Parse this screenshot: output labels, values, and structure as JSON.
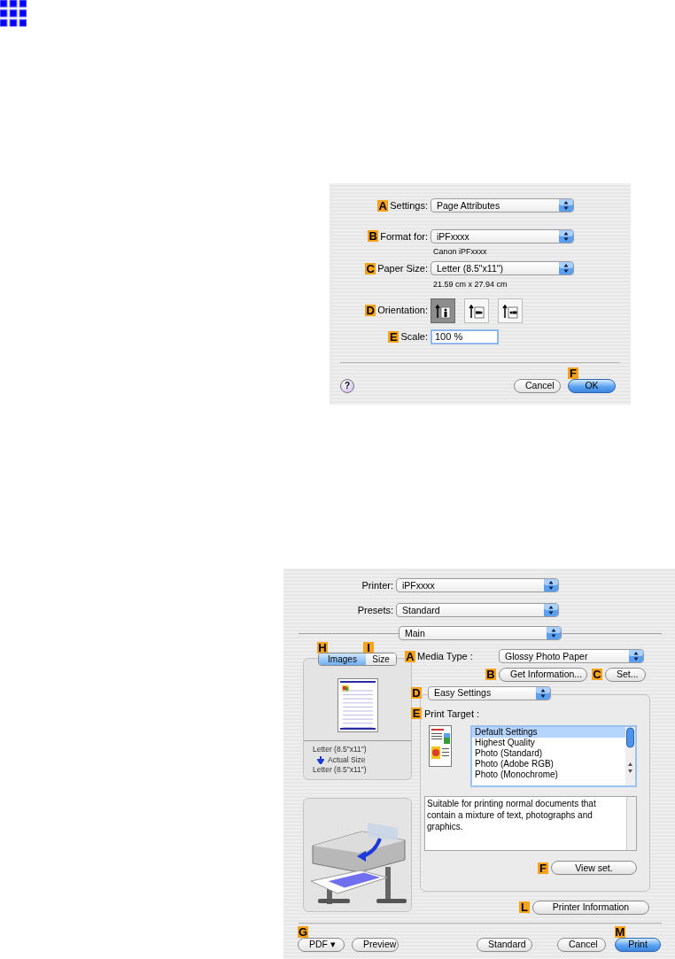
{
  "page_setup": {
    "rows": [
      {
        "badge": "A",
        "label": "Settings:",
        "kind": "popup",
        "value": "Page Attributes"
      },
      {
        "badge": "B",
        "label": "Format for:",
        "kind": "popup",
        "value": "iPFxxxx",
        "note": "Canon iPFxxxx"
      },
      {
        "badge": "C",
        "label": "Paper Size:",
        "kind": "popup",
        "value": "Letter (8.5\"x11\")",
        "note": "21.59 cm x 27.94 cm"
      },
      {
        "badge": "D",
        "label": "Orientation:",
        "kind": "orientation",
        "options": [
          {
            "kind": "portrait",
            "selected": true
          },
          {
            "kind": "landscape",
            "selected": false
          },
          {
            "kind": "reverse",
            "selected": false
          }
        ]
      },
      {
        "badge": "E",
        "label": "Scale:",
        "kind": "field",
        "value": "100 %"
      }
    ],
    "help": "?",
    "buttons": [
      {
        "label": "Cancel",
        "default": false
      },
      {
        "label": "OK",
        "default": true,
        "badge": "F"
      }
    ]
  },
  "print_dialog": {
    "printer": {
      "label": "Printer:",
      "value": "iPFxxxx"
    },
    "presets": {
      "label": "Presets:",
      "value": "Standard"
    },
    "panel": "Main",
    "preview_tabs": [
      {
        "badge": "H",
        "label": "Images",
        "selected": true
      },
      {
        "badge": "I",
        "label": "Size",
        "selected": false
      }
    ],
    "preview_lines": [
      {
        "kind": "size",
        "text": "Letter (8.5\"x11\")"
      },
      {
        "kind": "scale",
        "text": "Actual Size"
      },
      {
        "kind": "size",
        "text": "Letter (8.5\"x11\")"
      }
    ],
    "media_type": {
      "badge": "A",
      "label": "Media Type :",
      "value": "Glossy Photo Paper"
    },
    "get_info": {
      "badge": "B",
      "label": "Get Information..."
    },
    "set": {
      "badge": "C",
      "label": "Set..."
    },
    "mode": {
      "badge": "D",
      "value": "Easy Settings"
    },
    "print_target": {
      "badge": "E",
      "label": "Print Target :",
      "items": [
        {
          "label": "Default Settings",
          "selected": true
        },
        {
          "label": "Highest Quality",
          "selected": false
        },
        {
          "label": "Photo (Standard)",
          "selected": false
        },
        {
          "label": "Photo (Adobe RGB)",
          "selected": false
        },
        {
          "label": "Photo (Monochrome)",
          "selected": false
        }
      ]
    },
    "description": "Suitable for printing normal documents that contain a mixture of text, photographs and graphics.",
    "view_set": {
      "badge": "F",
      "label": "View set."
    },
    "printer_info": {
      "badge": "L",
      "label": "Printer Information"
    },
    "buttons": [
      {
        "label": "PDF ▾",
        "badge": "G",
        "default": false
      },
      {
        "label": "Preview",
        "default": false
      },
      {
        "label": "Standard",
        "default": false
      },
      {
        "label": "Cancel",
        "default": false
      },
      {
        "label": "Print",
        "badge": "M",
        "default": true
      }
    ]
  }
}
